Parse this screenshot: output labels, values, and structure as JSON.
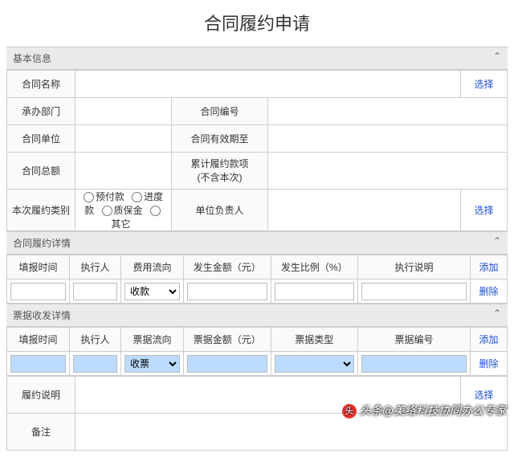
{
  "title": "合同履约申请",
  "panels": {
    "basic": {
      "header": "基本信息",
      "fields": {
        "contract_name": "合同名称",
        "select": "选择",
        "department": "承办部门",
        "contract_no": "合同编号",
        "contract_unit": "合同单位",
        "valid_until": "合同有效期至",
        "contract_total": "合同总额",
        "cumulative": "累计履约款项\n(不含本次)",
        "this_type": "本次履约类别",
        "unit_leader": "单位负责人",
        "select2": "选择"
      },
      "radios": [
        "预付款",
        "进度款",
        "质保金",
        "其它"
      ]
    },
    "perf": {
      "header": "合同履约详情",
      "cols": [
        "填报时间",
        "执行人",
        "费用流向",
        "发生金额（元）",
        "发生比例（%）",
        "执行说明"
      ],
      "add": "添加",
      "del": "删除",
      "flow_option": "收款"
    },
    "bill": {
      "header": "票据收发详情",
      "cols": [
        "填报时间",
        "执行人",
        "票据流向",
        "票据金额（元）",
        "票据类型",
        "票据编号"
      ],
      "add": "添加",
      "del": "删除",
      "flow_option": "收票"
    },
    "foot": {
      "desc_label": "履约说明",
      "select": "选择",
      "remark_label": "备注"
    }
  },
  "watermark": "头条@美络科技协同办公专家"
}
